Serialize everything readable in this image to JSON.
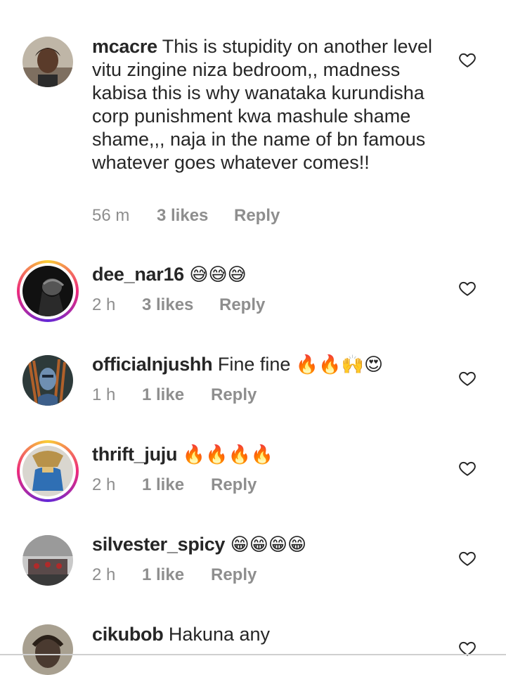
{
  "comments": [
    {
      "username": "mcacre",
      "text": "This is stupidity on another level vitu zingine niza bedroom,, madness kabisa this is why wanataka kurundisha corp punishment kwa mashule shame shame,,, naja in the name of bn famous whatever goes whatever comes!!",
      "emoji": "",
      "time": "56 m",
      "likes": "3 likes",
      "reply": "Reply",
      "story_ring": false
    },
    {
      "username": "dee_nar16",
      "text": "",
      "emoji": "😅😅😅",
      "time": "2 h",
      "likes": "3 likes",
      "reply": "Reply",
      "story_ring": true
    },
    {
      "username": "officialnjushh",
      "text": "Fine fine",
      "emoji": "🔥🔥🙌😍",
      "time": "1 h",
      "likes": "1 like",
      "reply": "Reply",
      "story_ring": false
    },
    {
      "username": "thrift_juju",
      "text": "",
      "emoji": "🔥🔥🔥🔥",
      "time": "2 h",
      "likes": "1 like",
      "reply": "Reply",
      "story_ring": true
    },
    {
      "username": "silvester_spicy",
      "text": "",
      "emoji": "😁😁😁😁",
      "time": "2 h",
      "likes": "1 like",
      "reply": "Reply",
      "story_ring": false
    },
    {
      "username": "cikubob",
      "text": "Hakuna any",
      "emoji": "",
      "time": "",
      "likes": "",
      "reply": "",
      "story_ring": false
    }
  ],
  "icons": {
    "like": "heart-outline-icon"
  },
  "colors": {
    "text": "#262626",
    "meta": "#8e8e8e",
    "heart": "#262626"
  }
}
